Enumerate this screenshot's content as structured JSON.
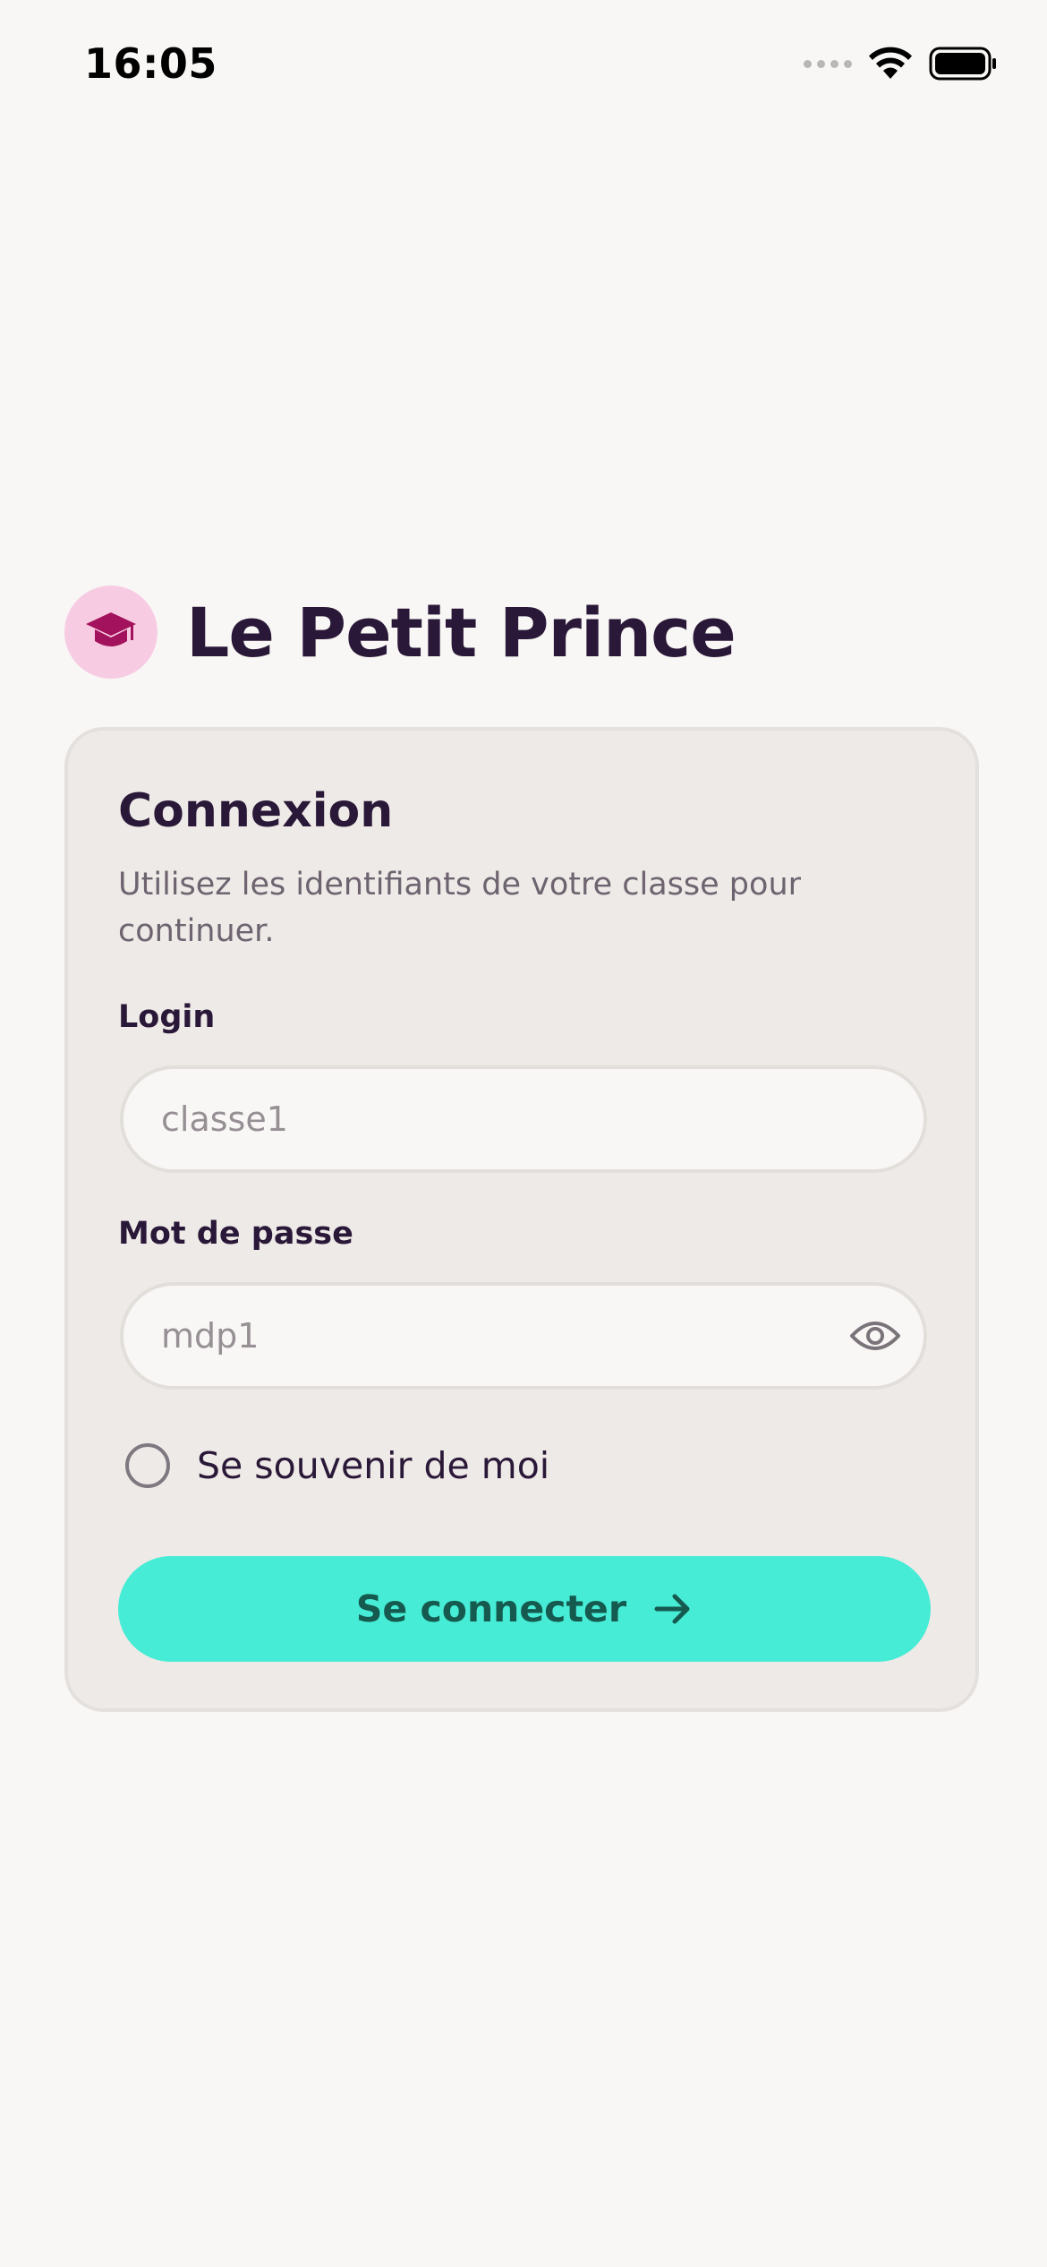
{
  "status_bar": {
    "time": "16:05",
    "icons": [
      "cellular-signal-icon",
      "wifi-icon",
      "battery-icon"
    ]
  },
  "brand": {
    "icon": "graduation-cap-icon",
    "title": "Le Petit Prince"
  },
  "login_card": {
    "title": "Connexion",
    "subtitle": "Utilisez les identifiants de votre classe pour continuer.",
    "login_field": {
      "label": "Login",
      "value": "",
      "placeholder": "classe1"
    },
    "password_field": {
      "label": "Mot de passe",
      "value": "",
      "placeholder": "mdp1",
      "toggle_icon": "eye-icon"
    },
    "remember_me": {
      "label": "Se souvenir de moi",
      "checked": false
    },
    "submit": {
      "label": "Se connecter",
      "icon": "arrow-right-icon"
    }
  },
  "colors": {
    "background": "#f9f7f5",
    "card_background": "#eeeae7",
    "brand_badge": "#f7cce3",
    "brand_icon": "#a3125c",
    "title_text": "#2a1838",
    "button_background": "#46ecd5",
    "button_text": "#15594f"
  }
}
